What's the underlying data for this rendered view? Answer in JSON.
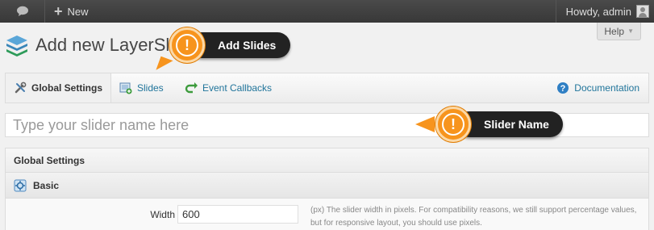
{
  "adminbar": {
    "comment_icon": "speech-bubble-icon",
    "new_label": "New",
    "howdy": "Howdy, admin"
  },
  "help": {
    "label": "Help"
  },
  "page": {
    "title": "Add new LayerSlider"
  },
  "tabs": [
    {
      "label": "Global Settings",
      "icon": "tools-icon"
    },
    {
      "label": "Slides",
      "icon": "slides-add-icon"
    },
    {
      "label": "Event Callbacks",
      "icon": "callback-arrow-icon"
    },
    {
      "label": "Documentation",
      "icon": "help-circle-icon"
    }
  ],
  "slider_name": {
    "placeholder": "Type your slider name here"
  },
  "settings": {
    "title": "Global Settings",
    "section": "Basic",
    "width_label": "Width",
    "width_value": "600",
    "width_desc": "(px) The slider width in pixels. For compatibility reasons, we still support percentage values, but for responsive layout, you should use pixels."
  },
  "callouts": {
    "add_slides": "Add Slides",
    "slider_name": "Slider Name",
    "badge_glyph": "!"
  },
  "colors": {
    "adminbar": "#464646",
    "link": "#21759b",
    "badge": "#f7941d",
    "callout": "#222222"
  }
}
